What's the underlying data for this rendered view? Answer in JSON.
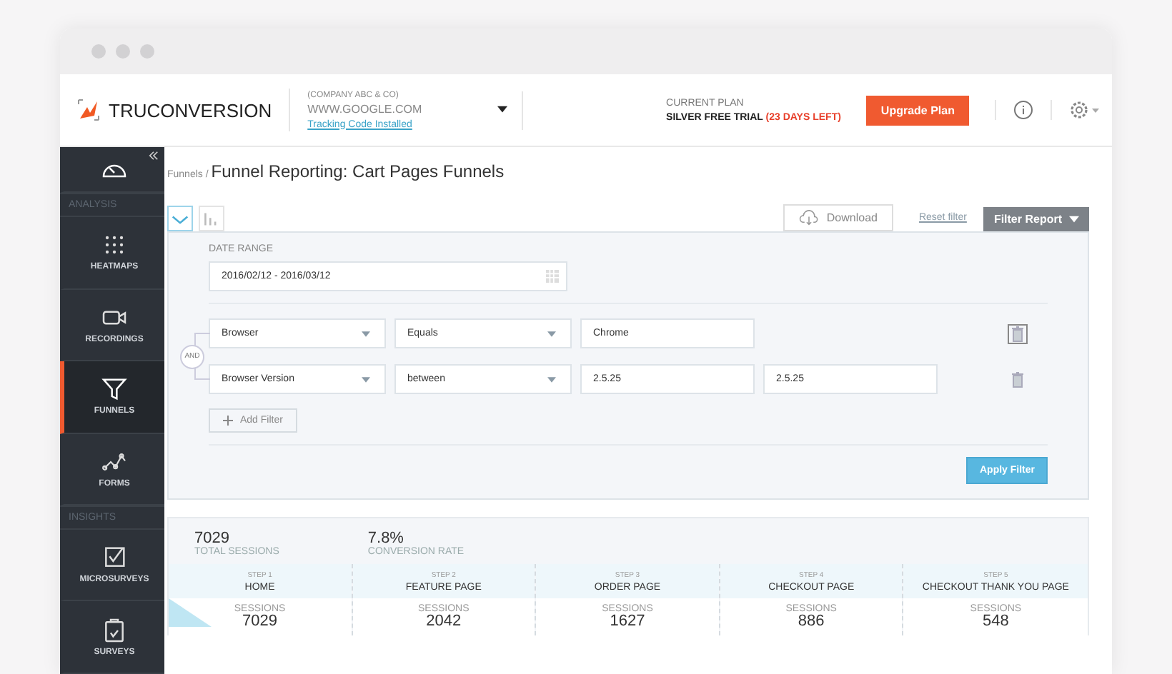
{
  "header": {
    "brand": "TRUCONVERSION",
    "company": "(COMPANY ABC & CO)",
    "domain": "WWW.GOOGLE.COM",
    "tracking_link": "Tracking Code Installed",
    "plan_label": "CURRENT PLAN",
    "plan_name": "SILVER FREE TRIAL",
    "plan_days": "(23 DAYS LEFT)",
    "upgrade_button": "Upgrade Plan"
  },
  "sidebar": {
    "items": [
      {
        "kind": "item",
        "selected": false
      },
      {
        "kind": "section",
        "label": "ANALYSIS"
      },
      {
        "kind": "item",
        "label": "HEATMAPS",
        "selected": false
      },
      {
        "kind": "item",
        "label": "RECORDINGS",
        "selected": false
      },
      {
        "kind": "item",
        "label": "FUNNELS",
        "selected": true
      },
      {
        "kind": "item",
        "label": "FORMS",
        "selected": false
      },
      {
        "kind": "section",
        "label": "INSIGHTS"
      },
      {
        "kind": "item",
        "label": "MICROSURVEYS",
        "selected": false
      },
      {
        "kind": "item",
        "label": "SURVEYS",
        "selected": false
      }
    ]
  },
  "breadcrumb": {
    "parent": "Funnels /",
    "title": "Funnel Reporting: Cart Pages Funnels"
  },
  "view_toggle": [
    {
      "selected": true
    },
    {
      "selected": false
    }
  ],
  "toolbar": {
    "download": "Download",
    "reset": "Reset filter",
    "filter_report": "Filter Report"
  },
  "filter": {
    "date_label": "DATE RANGE",
    "date_value": "2016/02/12 - 2016/03/12",
    "joiner": "AND",
    "rows": [
      {
        "field": "Browser",
        "operator": "Equals",
        "values": [
          "Chrome"
        ],
        "focused": true
      },
      {
        "field": "Browser Version",
        "operator": "between",
        "values": [
          "2.5.25",
          "2.5.25"
        ],
        "focused": false
      }
    ],
    "add_button": "Add Filter",
    "apply_button": "Apply Filter"
  },
  "stats": [
    {
      "value": "7029",
      "label": "TOTAL SESSIONS"
    },
    {
      "value": "7.8%",
      "label": "CONVERSION RATE"
    }
  ],
  "steps": [
    {
      "step": "STEP 1",
      "name": "HOME",
      "metric": "SESSIONS",
      "value": "7029"
    },
    {
      "step": "STEP 2",
      "name": "FEATURE PAGE",
      "metric": "SESSIONS",
      "value": "2042"
    },
    {
      "step": "STEP 3",
      "name": "ORDER PAGE",
      "metric": "SESSIONS",
      "value": "1627"
    },
    {
      "step": "STEP 4",
      "name": "CHECKOUT PAGE",
      "metric": "SESSIONS",
      "value": "886"
    },
    {
      "step": "STEP 5",
      "name": "CHECKOUT THANK YOU PAGE",
      "metric": "SESSIONS",
      "value": "548"
    }
  ]
}
